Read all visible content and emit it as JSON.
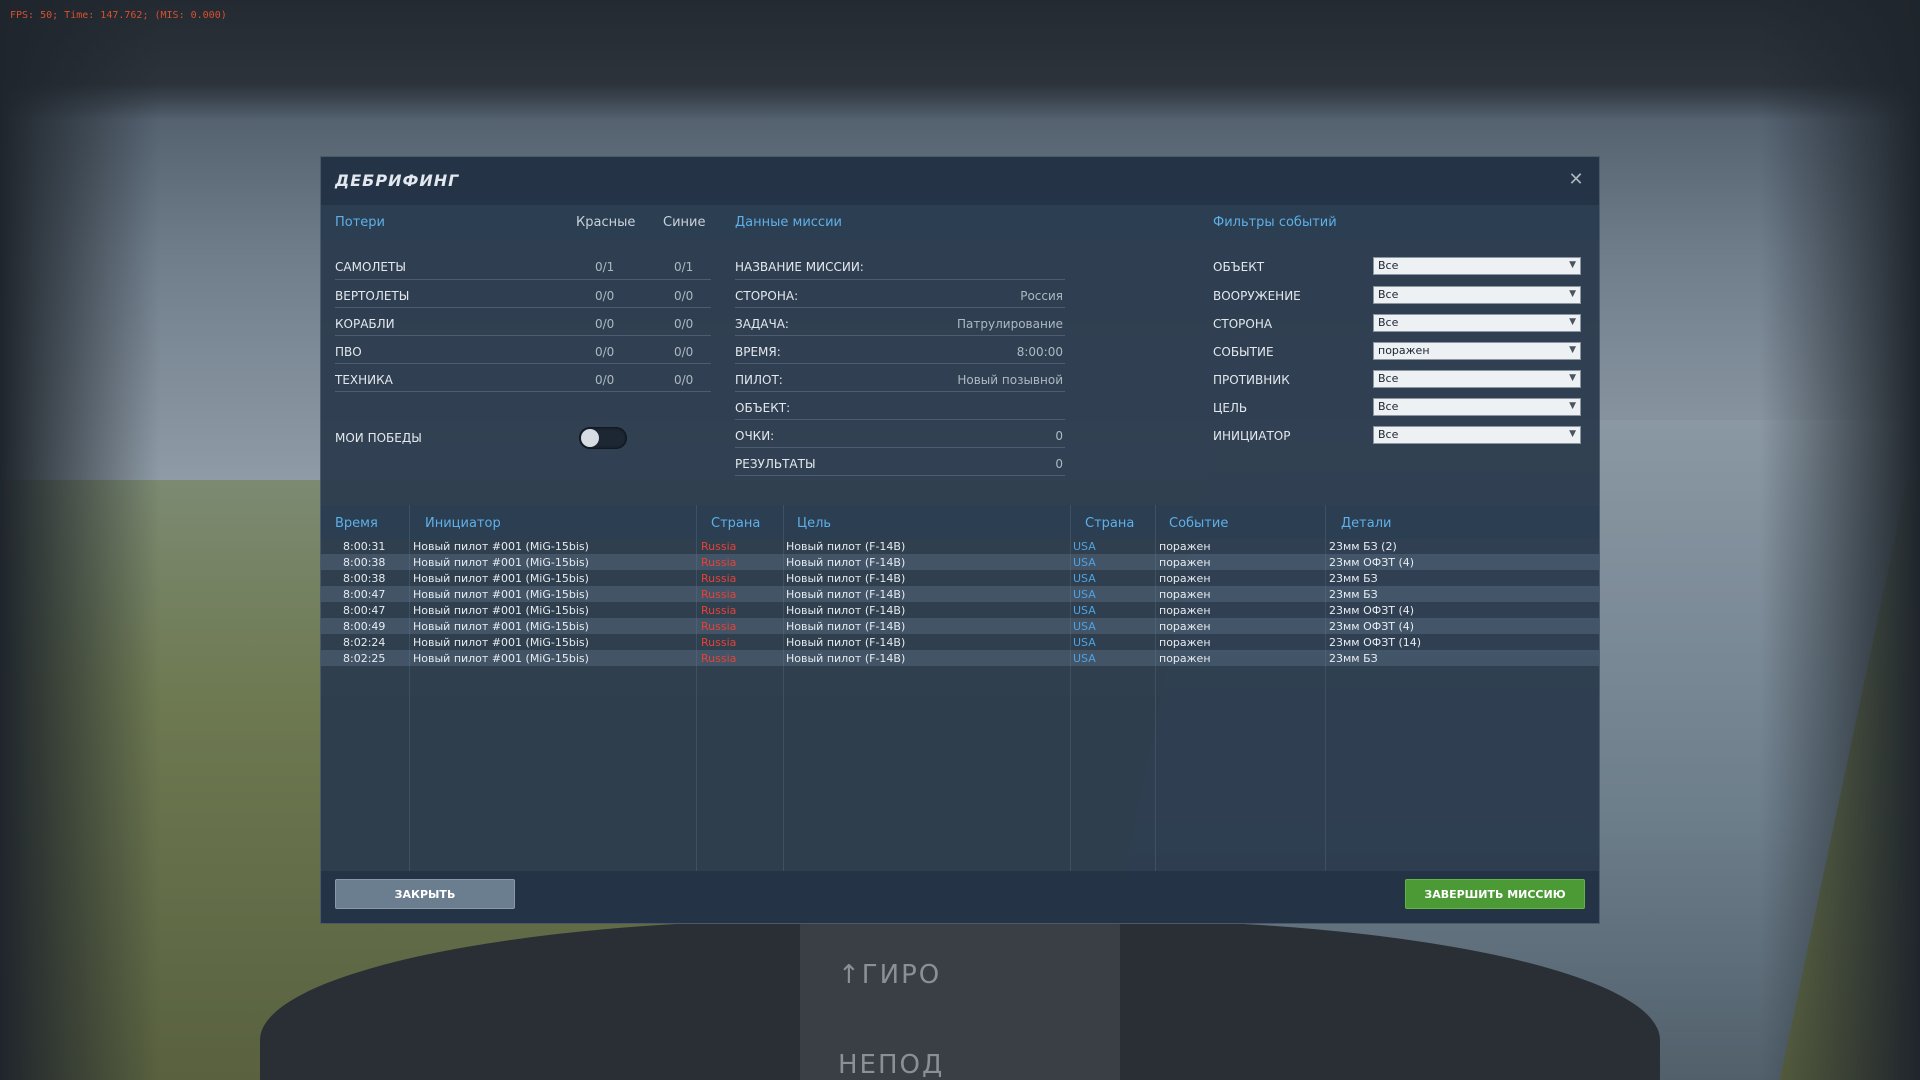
{
  "fps_overlay": "FPS:   50; Time: 147.762; (MIS: 0.000)",
  "background": {
    "dash_text_top": "↑ГИРО",
    "dash_text_bottom": "НЕПОД"
  },
  "dialog": {
    "title": "ДЕБРИФИНГ",
    "close_icon": "close-icon"
  },
  "losses": {
    "title": "Потери",
    "col_red": "Красные",
    "col_blue": "Синие",
    "rows": [
      {
        "label": "САМОЛЕТЫ",
        "red": "0/1",
        "blue": "0/1"
      },
      {
        "label": "ВЕРТОЛЕТЫ",
        "red": "0/0",
        "blue": "0/0"
      },
      {
        "label": "КОРАБЛИ",
        "red": "0/0",
        "blue": "0/0"
      },
      {
        "label": "ПВО",
        "red": "0/0",
        "blue": "0/0"
      },
      {
        "label": "ТЕХНИКА",
        "red": "0/0",
        "blue": "0/0"
      }
    ],
    "my_wins_label": "МОИ ПОБЕДЫ",
    "my_wins_on": false
  },
  "mission": {
    "title": "Данные миссии",
    "rows": [
      {
        "label": "НАЗВАНИЕ МИССИИ:",
        "value": ""
      },
      {
        "label": "СТОРОНА:",
        "value": "Россия"
      },
      {
        "label": "ЗАДАЧА:",
        "value": "Патрулирование"
      },
      {
        "label": "ВРЕМЯ:",
        "value": "8:00:00"
      },
      {
        "label": "ПИЛОТ:",
        "value": "Новый позывной"
      },
      {
        "label": "ОБЪЕКТ:",
        "value": ""
      },
      {
        "label": "ОЧКИ:",
        "value": "0"
      },
      {
        "label": "РЕЗУЛЬТАТЫ",
        "value": "0"
      }
    ]
  },
  "filters": {
    "title": "Фильтры событий",
    "rows": [
      {
        "label": "ОБЪЕКТ",
        "value": "Все"
      },
      {
        "label": "ВООРУЖЕНИЕ",
        "value": "Все"
      },
      {
        "label": "СТОРОНА",
        "value": "Все"
      },
      {
        "label": "СОБЫТИЕ",
        "value": "поражен"
      },
      {
        "label": "ПРОТИВНИК",
        "value": "Все"
      },
      {
        "label": "ЦЕЛЬ",
        "value": "Все"
      },
      {
        "label": "ИНИЦИАТОР",
        "value": "Все"
      }
    ]
  },
  "events": {
    "headers": {
      "time": "Время",
      "initiator": "Инициатор",
      "country1": "Страна",
      "target": "Цель",
      "country2": "Страна",
      "event": "Событие",
      "details": "Детали"
    },
    "rows": [
      {
        "time": "8:00:31",
        "initiator": "Новый пилот #001 (MiG-15bis)",
        "country1": "Russia",
        "target": "Новый пилот (F-14B)",
        "country2": "USA",
        "event": "поражен",
        "details": "23мм БЗ (2)"
      },
      {
        "time": "8:00:38",
        "initiator": "Новый пилот #001 (MiG-15bis)",
        "country1": "Russia",
        "target": "Новый пилот (F-14B)",
        "country2": "USA",
        "event": "поражен",
        "details": "23мм ОФЗТ (4)"
      },
      {
        "time": "8:00:38",
        "initiator": "Новый пилот #001 (MiG-15bis)",
        "country1": "Russia",
        "target": "Новый пилот (F-14B)",
        "country2": "USA",
        "event": "поражен",
        "details": "23мм БЗ"
      },
      {
        "time": "8:00:47",
        "initiator": "Новый пилот #001 (MiG-15bis)",
        "country1": "Russia",
        "target": "Новый пилот (F-14B)",
        "country2": "USA",
        "event": "поражен",
        "details": "23мм БЗ"
      },
      {
        "time": "8:00:47",
        "initiator": "Новый пилот #001 (MiG-15bis)",
        "country1": "Russia",
        "target": "Новый пилот (F-14B)",
        "country2": "USA",
        "event": "поражен",
        "details": "23мм ОФЗТ (4)"
      },
      {
        "time": "8:00:49",
        "initiator": "Новый пилот #001 (MiG-15bis)",
        "country1": "Russia",
        "target": "Новый пилот (F-14B)",
        "country2": "USA",
        "event": "поражен",
        "details": "23мм ОФЗТ (4)"
      },
      {
        "time": "8:02:24",
        "initiator": "Новый пилот #001 (MiG-15bis)",
        "country1": "Russia",
        "target": "Новый пилот (F-14B)",
        "country2": "USA",
        "event": "поражен",
        "details": "23мм ОФЗТ (14)"
      },
      {
        "time": "8:02:25",
        "initiator": "Новый пилот #001 (MiG-15bis)",
        "country1": "Russia",
        "target": "Новый пилот (F-14B)",
        "country2": "USA",
        "event": "поражен",
        "details": "23мм БЗ"
      }
    ]
  },
  "footer": {
    "close_label": "ЗАКРЫТЬ",
    "finish_label": "ЗАВЕРШИТЬ МИССИЮ"
  },
  "colors": {
    "accent_blue": "#5fb0e8",
    "red_country": "#e3433a",
    "blue_country": "#4da3e6",
    "finish_button": "#4c9a36"
  }
}
